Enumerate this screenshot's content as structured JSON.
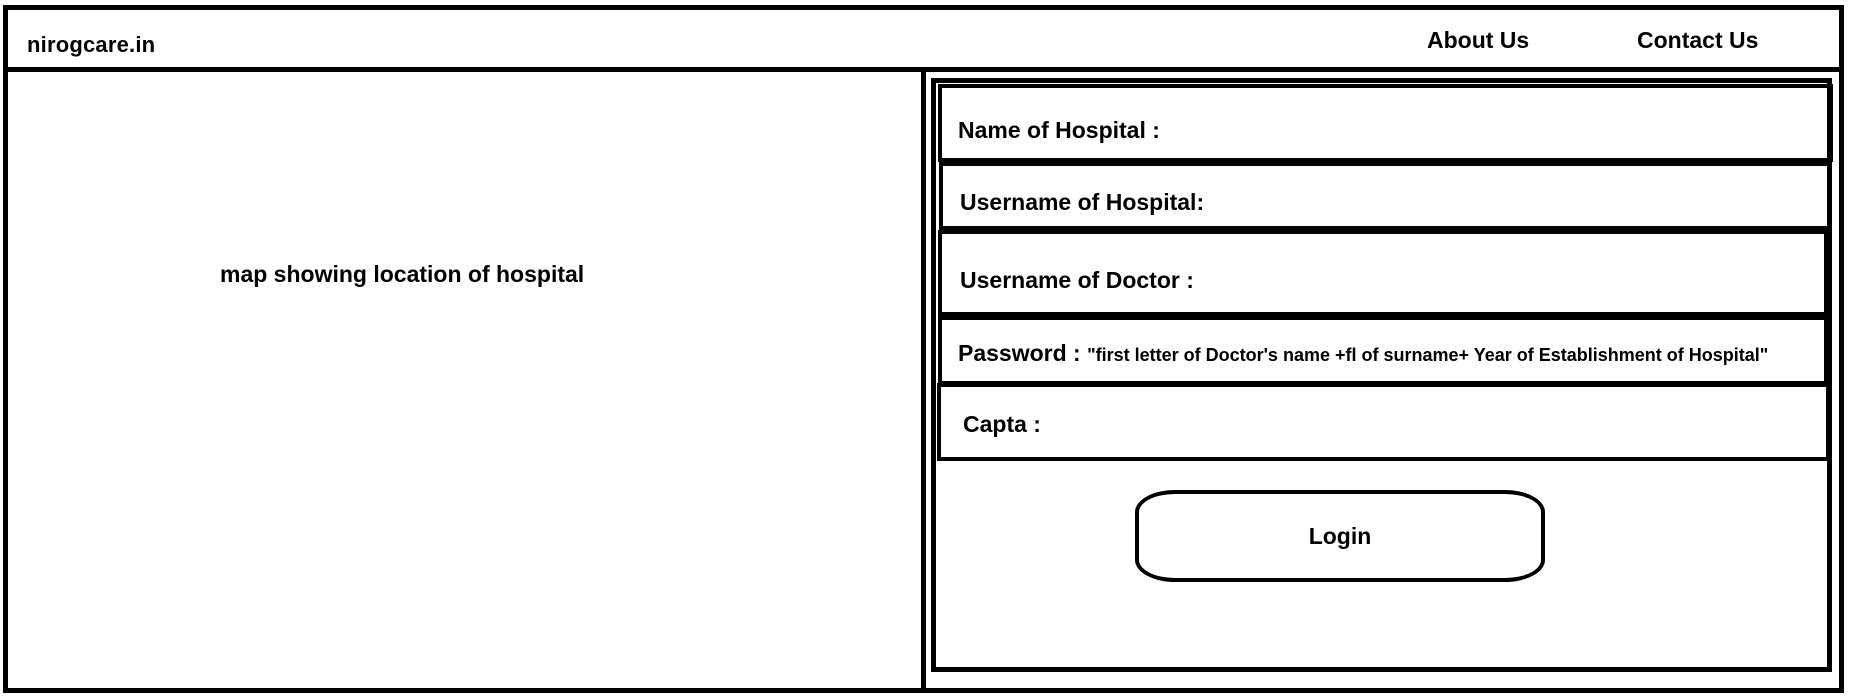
{
  "header": {
    "brand": "nirogcare.in",
    "nav": {
      "about": "About Us",
      "contact": "Contact Us"
    }
  },
  "map": {
    "label": "map showing location of hospital"
  },
  "form": {
    "hospital_name_label": "Name of Hospital :",
    "hospital_username_label": "Username of Hospital:",
    "doctor_username_label": "Username of Doctor :",
    "password_label": "Password :",
    "password_hint": "\"first letter of Doctor's name +fl of surname+ Year of Establishment of Hospital\"",
    "captcha_label": "Capta :",
    "login_label": "Login"
  }
}
